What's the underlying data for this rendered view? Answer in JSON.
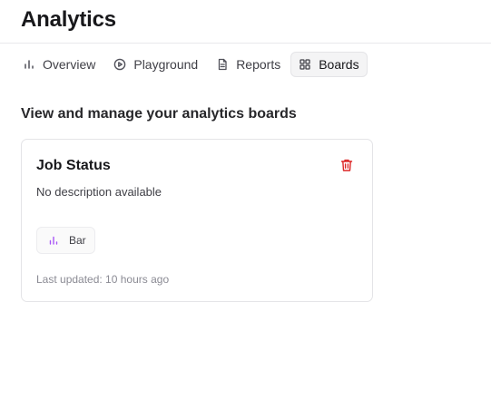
{
  "header": {
    "title": "Analytics"
  },
  "tabs": [
    {
      "label": "Overview",
      "icon": "bar-chart-icon",
      "active": false
    },
    {
      "label": "Playground",
      "icon": "play-circle-icon",
      "active": false
    },
    {
      "label": "Reports",
      "icon": "document-icon",
      "active": false
    },
    {
      "label": "Boards",
      "icon": "grid-icon",
      "active": true
    }
  ],
  "main": {
    "heading": "View and manage your analytics boards",
    "boards": [
      {
        "title": "Job Status",
        "description": "No description available",
        "chart_type": "Bar",
        "chart_icon": "bar-chart-icon",
        "updated": "Last updated: 10 hours ago",
        "delete_icon": "trash-icon"
      }
    ]
  },
  "colors": {
    "accent_purple": "#a855f7",
    "danger_red": "#dc2626",
    "text_primary": "#18181b",
    "text_muted": "#8b8b94",
    "border": "#e4e4e7"
  }
}
